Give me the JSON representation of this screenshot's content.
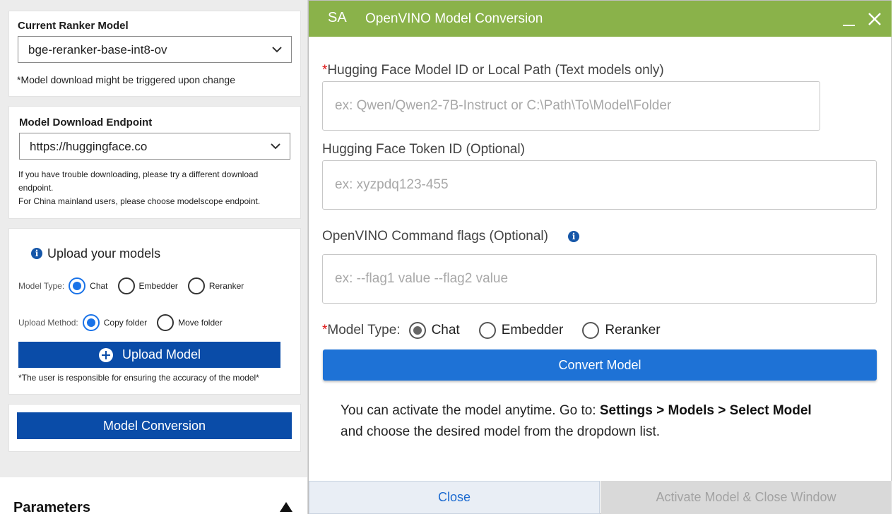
{
  "sidebar": {
    "ranker": {
      "title": "Current Ranker Model",
      "selected": "bge-reranker-base-int8-ov",
      "note": "*Model download might be triggered upon change"
    },
    "endpoint": {
      "title": "Model Download Endpoint",
      "selected": "https://huggingface.co",
      "note_line1": "If you have trouble downloading, please try a different download",
      "note_line2": "endpoint.",
      "note_line3": "For China mainland users, please choose modelscope endpoint."
    },
    "upload": {
      "title": "Upload your models",
      "model_type_label": "Model Type:",
      "model_types": [
        "Chat",
        "Embedder",
        "Reranker"
      ],
      "model_type_selected": "Chat",
      "method_label": "Upload Method:",
      "methods": [
        "Copy folder",
        "Move folder"
      ],
      "method_selected": "Copy folder",
      "button": "Upload Model",
      "disclaimer": "*The user is responsible for ensuring the accuracy of the model*"
    },
    "conversion_button": "Model Conversion",
    "parameters_title": "Parameters"
  },
  "dialog": {
    "badge": "SA",
    "title": "OpenVINO Model Conversion",
    "model_id": {
      "required_mark": "*",
      "label": "Hugging Face Model ID or Local Path (Text models only)",
      "placeholder": "ex: Qwen/Qwen2-7B-Instruct or C:\\Path\\To\\Model\\Folder"
    },
    "token": {
      "label": "Hugging Face Token ID (Optional)",
      "placeholder": "ex: xyzpdq123-455"
    },
    "flags": {
      "label": "OpenVINO Command flags (Optional)",
      "placeholder": "ex: --flag1 value --flag2 value"
    },
    "model_type": {
      "required_mark": "*",
      "label": "Model Type:",
      "options": [
        "Chat",
        "Embedder",
        "Reranker"
      ],
      "selected": "Chat"
    },
    "convert_button": "Convert Model",
    "hint_prefix": "You can activate the model anytime. Go to: ",
    "hint_path": "Settings > Models > Select Model",
    "hint_suffix": "and choose the desired model from the dropdown list.",
    "close_button": "Close",
    "activate_button": "Activate Model & Close Window"
  }
}
